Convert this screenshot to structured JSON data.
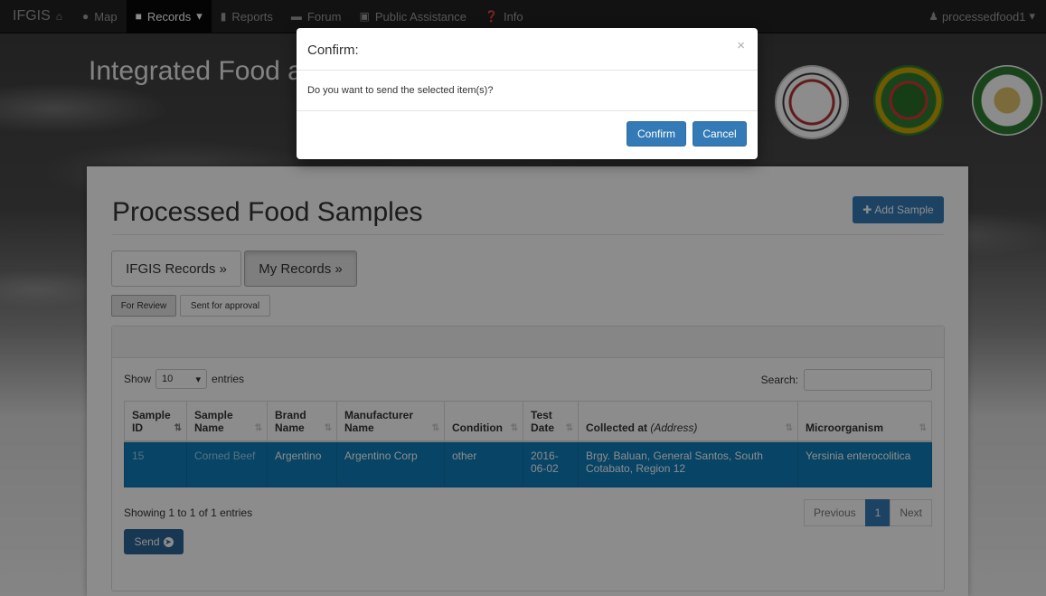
{
  "navbar": {
    "brand": "IFGIS",
    "items": [
      {
        "label": "Map",
        "icon": "map-marker-icon"
      },
      {
        "label": "Records",
        "icon": "file-icon",
        "caret": "▾"
      },
      {
        "label": "Reports",
        "icon": "bar-chart-icon"
      },
      {
        "label": "Forum",
        "icon": "comment-icon"
      },
      {
        "label": "Public Assistance",
        "icon": "book-icon"
      },
      {
        "label": "Info",
        "icon": "question-icon"
      }
    ],
    "user": "processedfood1",
    "user_caret": "▾"
  },
  "header": {
    "site_title": "Integrated Food a"
  },
  "page": {
    "title": "Processed Food Samples",
    "add_button": "Add Sample",
    "tabs": [
      "IFGIS Records »",
      "My Records »"
    ],
    "subtabs": [
      "For Review",
      "Sent for approval"
    ]
  },
  "datatable": {
    "show_label": "Show",
    "entries_value": "10",
    "entries_label": "entries",
    "search_label": "Search:",
    "columns": [
      "Sample ID",
      "Sample Name",
      "Brand Name",
      "Manufacturer Name",
      "Condition",
      "Test Date",
      "Collected at",
      "Microorganism"
    ],
    "collected_suffix": "(Address)",
    "rows": [
      {
        "sample_id": "15",
        "sample_name": "Corned Beef",
        "brand_name": "Argentino",
        "manufacturer": "Argentino Corp",
        "condition": "other",
        "test_date": "2016-06-02",
        "collected_at": "Brgy. Baluan, General Santos, South Cotabato, Region 12",
        "microorganism": "Yersinia enterocolitica"
      }
    ],
    "info": "Showing 1 to 1 of 1 entries",
    "pager": {
      "previous": "Previous",
      "current": "1",
      "next": "Next"
    },
    "send_button": "Send"
  },
  "modal": {
    "title": "Confirm:",
    "close": "×",
    "message": "Do you want to send the selected item(s)?",
    "confirm": "Confirm",
    "cancel": "Cancel"
  },
  "colors": {
    "navbar": "#222222",
    "primary": "#337ab7",
    "selected_row": "#0e7db8"
  }
}
